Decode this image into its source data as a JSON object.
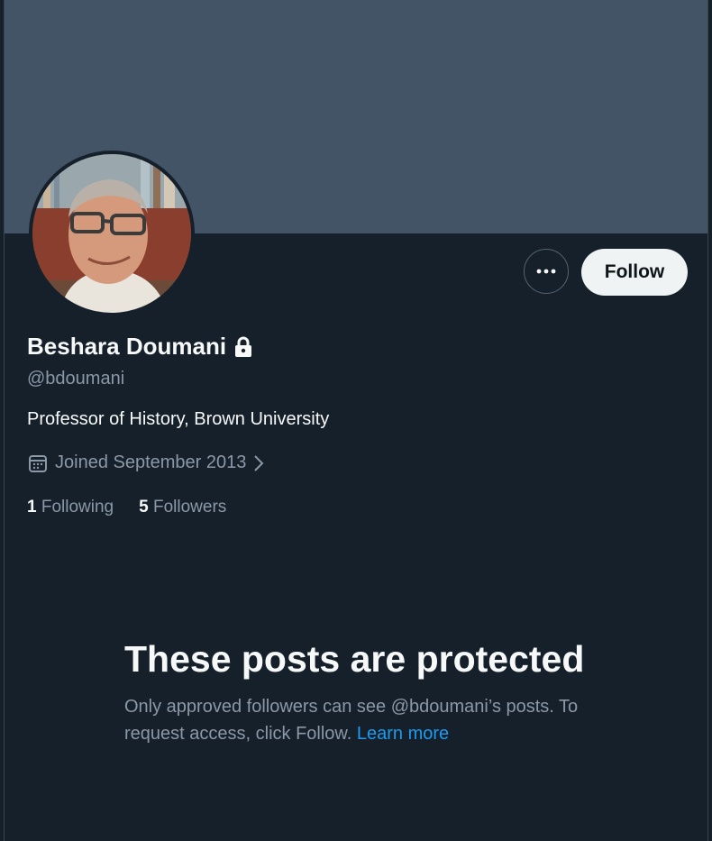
{
  "profile": {
    "name": "Beshara Doumani",
    "handle": "@bdoumani",
    "bio": "Professor of History, Brown University",
    "joined": "Joined September 2013",
    "following_count": "1",
    "following_label": "Following",
    "followers_count": "5",
    "followers_label": "Followers"
  },
  "actions": {
    "more_icon": "more-horizontal-icon",
    "follow_label": "Follow"
  },
  "protected_notice": {
    "title": "These posts are protected",
    "desc": "Only approved followers can see @bdoumani’s posts. To request access, click Follow. ",
    "learn_more": "Learn more"
  },
  "colors": {
    "background": "#15202b",
    "banner": "#425466",
    "primary_text": "#f7f9f9",
    "secondary_text": "#8b98a5",
    "link": "#1d9bf0",
    "follow_button_bg": "#eff3f4"
  }
}
